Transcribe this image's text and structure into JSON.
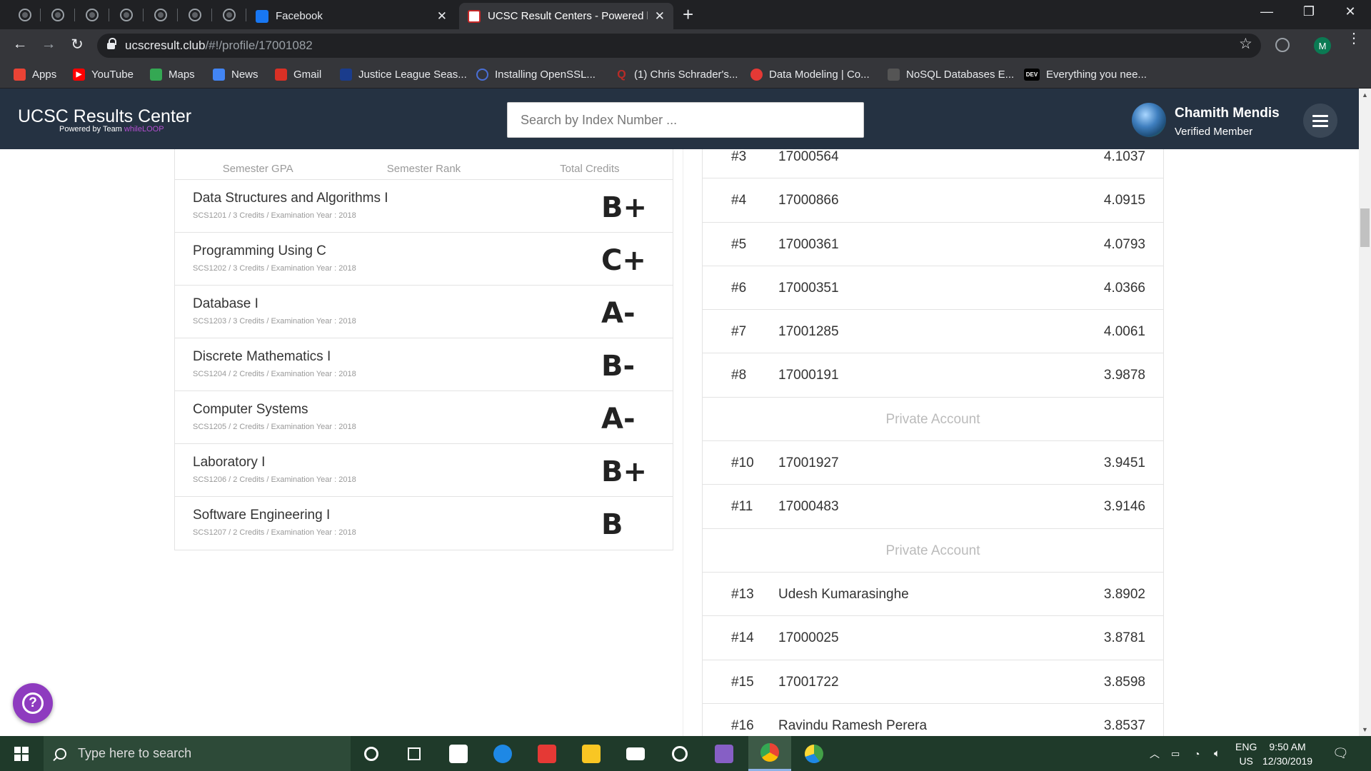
{
  "browser": {
    "tabs": [
      {
        "title": "Facebook",
        "active": false
      },
      {
        "title": "UCSC Result Centers - Powered b",
        "active": true
      }
    ],
    "url_host": "ucscresult.club",
    "url_path": "/#!/profile/17001082",
    "profile_initial": "M",
    "bookmarks": [
      {
        "label": "Apps",
        "icon": "apps-grid-icon",
        "color": "#ea4335"
      },
      {
        "label": "YouTube",
        "icon": "youtube-icon",
        "color": "#ff0000"
      },
      {
        "label": "Maps",
        "icon": "maps-icon",
        "color": "#34a853"
      },
      {
        "label": "News",
        "icon": "news-icon",
        "color": "#4285f4"
      },
      {
        "label": "Gmail",
        "icon": "gmail-icon",
        "color": "#d93025"
      },
      {
        "label": "Justice League Seas...",
        "icon": "site-icon",
        "color": "#1a3c8c"
      },
      {
        "label": "Installing OpenSSL...",
        "icon": "loading-icon",
        "color": "#4a6fd6"
      },
      {
        "label": "(1) Chris Schrader's...",
        "icon": "quora-icon",
        "color": "#b92b27"
      },
      {
        "label": "Data Modeling | Co...",
        "icon": "site-icon",
        "color": "#e53935"
      },
      {
        "label": "NoSQL Databases E...",
        "icon": "site-icon",
        "color": "#555555"
      },
      {
        "label": "Everything you nee...",
        "icon": "dev-icon",
        "color": "#000000",
        "text": "DEV"
      }
    ]
  },
  "app": {
    "title": "UCSC Results Center",
    "powered_prefix": "Powered by Team ",
    "powered_team": "whileLOOP",
    "search_placeholder": "Search by Index Number ...",
    "user_name": "Chamith Mendis",
    "user_status": "Verified Member"
  },
  "grades": {
    "stats_headers": [
      "Semester GPA",
      "Semester Rank",
      "Total Credits"
    ],
    "courses": [
      {
        "name": "Data Structures and Algorithms I",
        "meta": "SCS1201 / 3 Credits / Examination Year : 2018",
        "grade": "B+"
      },
      {
        "name": "Programming Using C",
        "meta": "SCS1202 / 3 Credits / Examination Year : 2018",
        "grade": "C+"
      },
      {
        "name": "Database I",
        "meta": "SCS1203 / 3 Credits / Examination Year : 2018",
        "grade": "A-"
      },
      {
        "name": "Discrete Mathematics I",
        "meta": "SCS1204 / 2 Credits / Examination Year : 2018",
        "grade": "B-"
      },
      {
        "name": "Computer Systems",
        "meta": "SCS1205 / 2 Credits / Examination Year : 2018",
        "grade": "A-"
      },
      {
        "name": "Laboratory I",
        "meta": "SCS1206 / 2 Credits / Examination Year : 2018",
        "grade": "B+"
      },
      {
        "name": "Software Engineering I",
        "meta": "SCS1207 / 2 Credits / Examination Year : 2018",
        "grade": "B"
      }
    ]
  },
  "ranking": {
    "private_label": "Private Account",
    "rows": [
      {
        "pos": "#3",
        "id": "17000564",
        "gpa": "4.1037"
      },
      {
        "pos": "#4",
        "id": "17000866",
        "gpa": "4.0915"
      },
      {
        "pos": "#5",
        "id": "17000361",
        "gpa": "4.0793"
      },
      {
        "pos": "#6",
        "id": "17000351",
        "gpa": "4.0366"
      },
      {
        "pos": "#7",
        "id": "17001285",
        "gpa": "4.0061"
      },
      {
        "pos": "#8",
        "id": "17000191",
        "gpa": "3.9878"
      },
      {
        "private": true
      },
      {
        "pos": "#10",
        "id": "17001927",
        "gpa": "3.9451"
      },
      {
        "pos": "#11",
        "id": "17000483",
        "gpa": "3.9146"
      },
      {
        "private": true
      },
      {
        "pos": "#13",
        "id": "Udesh Kumarasinghe",
        "gpa": "3.8902"
      },
      {
        "pos": "#14",
        "id": "17000025",
        "gpa": "3.8781"
      },
      {
        "pos": "#15",
        "id": "17001722",
        "gpa": "3.8598"
      },
      {
        "pos": "#16",
        "id": "Ravindu Ramesh Perera",
        "gpa": "3.8537"
      }
    ]
  },
  "taskbar": {
    "search_placeholder": "Type here to search",
    "lang_top": "ENG",
    "lang_bottom": "US",
    "time": "9:50 AM",
    "date": "12/30/2019",
    "apps": [
      {
        "name": "cortana-icon",
        "color": "#ffffff"
      },
      {
        "name": "task-view-icon",
        "color": "#ffffff"
      },
      {
        "name": "store-icon",
        "color": "#0078d7"
      },
      {
        "name": "edge-icon",
        "color": "#1e88e5"
      },
      {
        "name": "gift-icon",
        "color": "#e53935"
      },
      {
        "name": "file-explorer-icon",
        "color": "#f9c623"
      },
      {
        "name": "mail-icon",
        "color": "#ffffff"
      },
      {
        "name": "media-icon",
        "color": "#ffffff"
      },
      {
        "name": "visual-studio-icon",
        "color": "#865fc5"
      },
      {
        "name": "chrome-icon",
        "color": "#4caf50",
        "active": true
      },
      {
        "name": "paint-icon",
        "color": "#43a047"
      }
    ]
  }
}
